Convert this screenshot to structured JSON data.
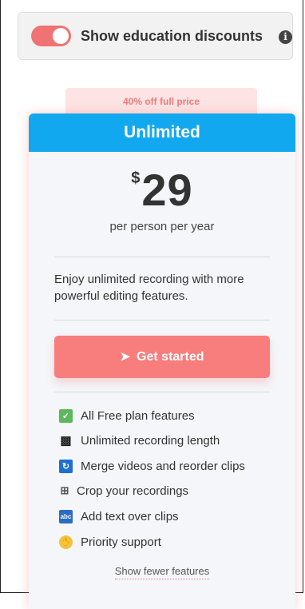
{
  "toggle": {
    "label": "Show education discounts",
    "checked": true,
    "info_icon": "info-icon",
    "color": "#f07272"
  },
  "badge": {
    "text": "40% off full price"
  },
  "plan": {
    "name": "Unlimited",
    "header_color": "#12a8ef",
    "currency": "$",
    "price": "29",
    "period": "per person per year",
    "description": "Enjoy unlimited recording with more powerful editing features.",
    "cta": {
      "label": "Get started",
      "icon": "rocket-icon",
      "color": "#f87d7d"
    },
    "features": [
      {
        "icon": "checkmark-icon",
        "label": "All Free plan features"
      },
      {
        "icon": "video-camera-icon",
        "label": "Unlimited recording length"
      },
      {
        "icon": "merge-loop-icon",
        "label": "Merge videos and reorder clips"
      },
      {
        "icon": "crop-icon",
        "label": "Crop your recordings"
      },
      {
        "icon": "text-overlay-icon",
        "label": "Add text over clips"
      },
      {
        "icon": "waving-hand-icon",
        "label": "Priority support"
      }
    ],
    "toggle_features_label": "Show fewer features"
  }
}
